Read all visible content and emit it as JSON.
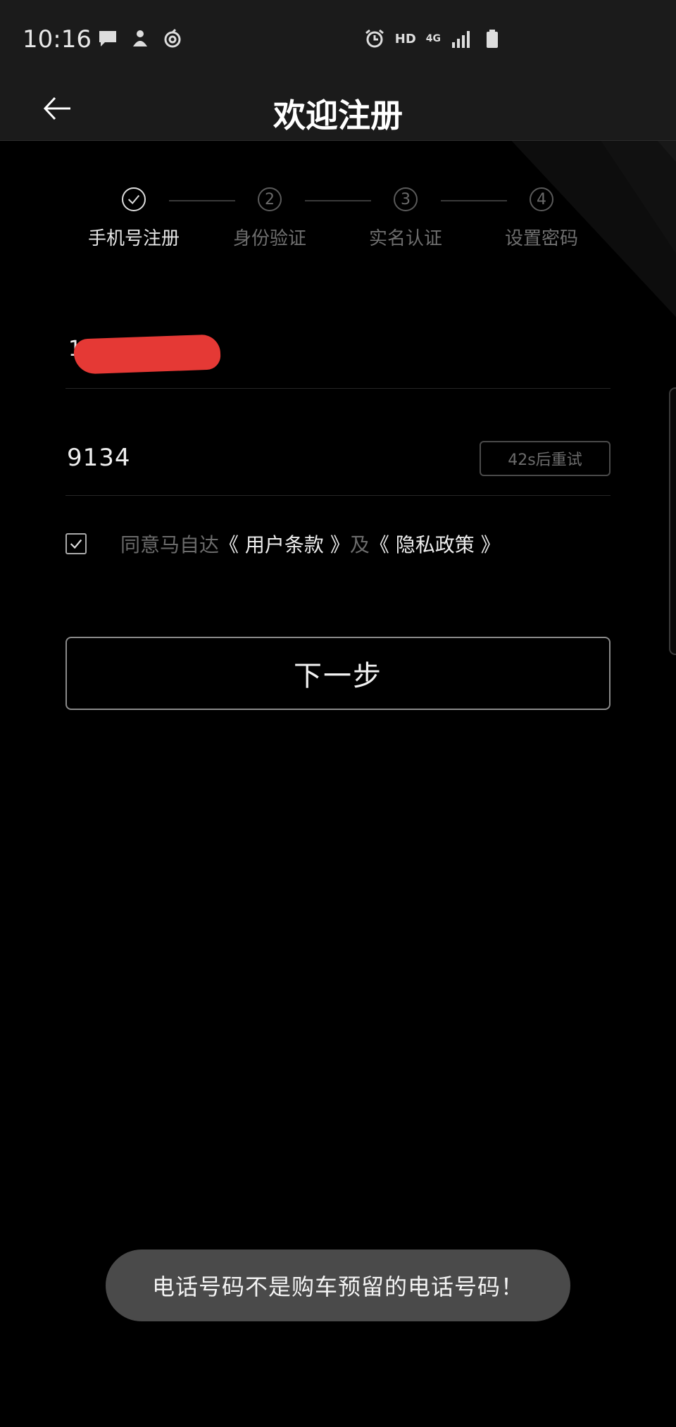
{
  "status_bar": {
    "time": "10:16",
    "hd": "HD",
    "network": "4G"
  },
  "header": {
    "title": "欢迎注册"
  },
  "stepper": {
    "steps": [
      {
        "number": "",
        "label": "手机号注册",
        "state": "done"
      },
      {
        "number": "2",
        "label": "身份验证",
        "state": "pending"
      },
      {
        "number": "3",
        "label": "实名认证",
        "state": "pending"
      },
      {
        "number": "4",
        "label": "设置密码",
        "state": "pending"
      }
    ]
  },
  "form": {
    "phone": {
      "value": "1         4"
    },
    "code": {
      "value": "9134",
      "retry_label": "42s后重试"
    },
    "agreement": {
      "prefix": "同意马自达",
      "terms": "《 用户条款 》",
      "and": "及",
      "privacy": "《 隐私政策 》",
      "checked": true
    },
    "next_label": "下一步"
  },
  "toast": {
    "message": "电话号码不是购车预留的电话号码！"
  },
  "colors": {
    "background": "#000000",
    "header": "#1b1b1b",
    "toast": "#4a4a4a",
    "redaction": "#e53935"
  }
}
